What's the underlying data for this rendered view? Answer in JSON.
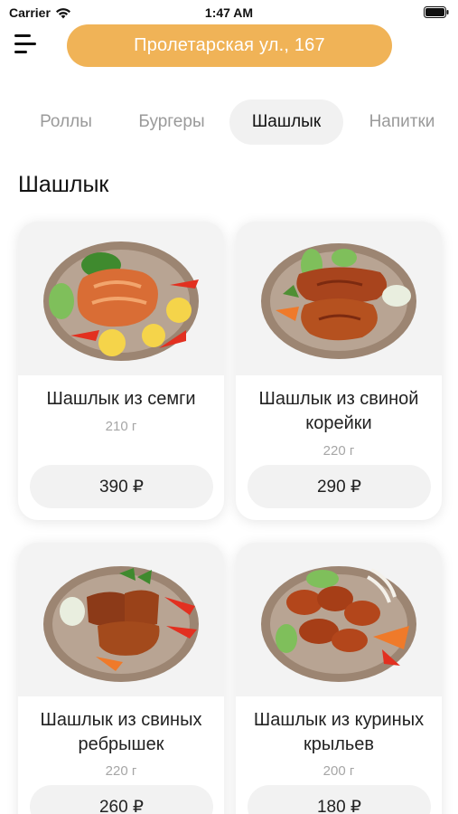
{
  "status_bar": {
    "carrier": "Carrier",
    "time": "1:47 AM",
    "icons": [
      "wifi-icon",
      "battery-icon"
    ]
  },
  "header": {
    "menu_icon": "menu-icon",
    "address": "Пролетарская ул., 167",
    "accent_color": "#f0b357"
  },
  "tabs": [
    {
      "label": "Роллы",
      "active": false
    },
    {
      "label": "Бургеры",
      "active": false
    },
    {
      "label": "Шашлык",
      "active": true
    },
    {
      "label": "Напитки",
      "active": false
    }
  ],
  "section": {
    "title": "Шашлык"
  },
  "products": [
    {
      "name": "Шашлык из семги",
      "weight": "210 г",
      "price": "390 ₽",
      "image": "salmon-steak-photo"
    },
    {
      "name": "Шашлык из свиной корейки",
      "weight": "220 г",
      "price": "290 ₽",
      "image": "pork-loin-photo"
    },
    {
      "name": "Шашлык из свиных ребрышек",
      "weight": "220 г",
      "price": "260 ₽",
      "image": "pork-ribs-photo"
    },
    {
      "name": "Шашлык из куриных крыльев",
      "weight": "200 г",
      "price": "180 ₽",
      "image": "chicken-wings-photo"
    }
  ]
}
